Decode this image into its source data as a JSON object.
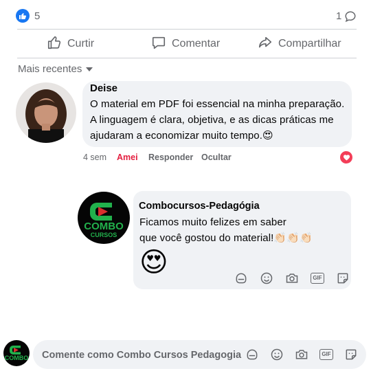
{
  "reactions": {
    "count": "5",
    "comments_count": "1"
  },
  "actions": {
    "like": "Curtir",
    "comment": "Comentar",
    "share": "Compartilhar"
  },
  "sort": {
    "label": "Mais recentes"
  },
  "comment1": {
    "author": "Deise",
    "lines": [
      "O material em PDF foi essencial na minha preparação.",
      "A linguagem é clara, objetiva, e as dicas práticas me",
      "ajudaram a economizar muito tempo.😍"
    ],
    "time": "4 sem",
    "reaction_label": "Amei",
    "reply": "Responder",
    "hide": "Ocultar",
    "colors": {
      "amei": "#e41e3f"
    }
  },
  "reply": {
    "author": "Combocursos-Pedagógia",
    "lines": [
      "Ficamos muito felizes em saber",
      "que você gostou do material!👏🏻👏🏻👏🏻"
    ],
    "emoji": "😍",
    "logo_text": [
      "COMBO",
      "CURSOS"
    ]
  },
  "composer": {
    "placeholder": "Comente como Combo Cursos Pedagogia"
  }
}
